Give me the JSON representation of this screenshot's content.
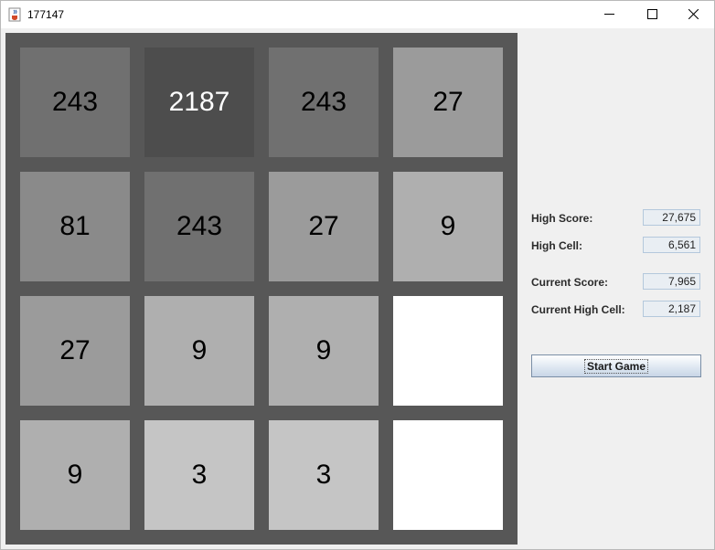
{
  "window": {
    "title": "177147"
  },
  "board": {
    "tiles": [
      {
        "value": "243",
        "bg": "#707070",
        "color": "#000000"
      },
      {
        "value": "2187",
        "bg": "#4d4d4d",
        "color": "#ffffff"
      },
      {
        "value": "243",
        "bg": "#707070",
        "color": "#000000"
      },
      {
        "value": "27",
        "bg": "#9b9b9b",
        "color": "#000000"
      },
      {
        "value": "81",
        "bg": "#8a8a8a",
        "color": "#000000"
      },
      {
        "value": "243",
        "bg": "#707070",
        "color": "#000000"
      },
      {
        "value": "27",
        "bg": "#9b9b9b",
        "color": "#000000"
      },
      {
        "value": "9",
        "bg": "#afafaf",
        "color": "#000000"
      },
      {
        "value": "27",
        "bg": "#9b9b9b",
        "color": "#000000"
      },
      {
        "value": "9",
        "bg": "#afafaf",
        "color": "#000000"
      },
      {
        "value": "9",
        "bg": "#afafaf",
        "color": "#000000"
      },
      {
        "value": "",
        "bg": "#ffffff",
        "color": "#000000"
      },
      {
        "value": "9",
        "bg": "#afafaf",
        "color": "#000000"
      },
      {
        "value": "3",
        "bg": "#c5c5c5",
        "color": "#000000"
      },
      {
        "value": "3",
        "bg": "#c5c5c5",
        "color": "#000000"
      },
      {
        "value": "",
        "bg": "#ffffff",
        "color": "#000000"
      }
    ]
  },
  "stats": {
    "high_score_label": "High Score:",
    "high_score_value": "27,675",
    "high_cell_label": "High Cell:",
    "high_cell_value": "6,561",
    "current_score_label": "Current Score:",
    "current_score_value": "7,965",
    "current_high_cell_label": "Current High Cell:",
    "current_high_cell_value": "2,187"
  },
  "controls": {
    "start_label": "Start Game"
  },
  "icons": {
    "app": "java-cup-icon",
    "minimize": "minimize-icon",
    "maximize": "maximize-icon",
    "close": "close-icon"
  }
}
